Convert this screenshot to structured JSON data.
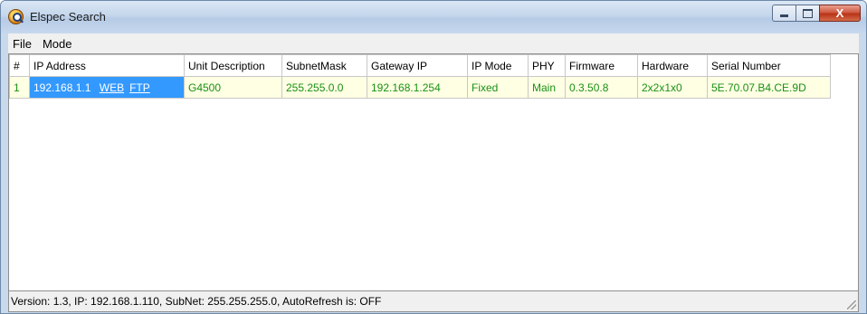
{
  "window": {
    "title": "Elspec Search",
    "icon": "elspec-search-icon",
    "controls": {
      "close_label": "X"
    }
  },
  "menu": [
    "File",
    "Mode"
  ],
  "table": {
    "columns": [
      "#",
      "IP Address",
      "Unit Description",
      "SubnetMask",
      "Gateway IP",
      "IP Mode",
      "PHY",
      "Firmware",
      "Hardware",
      "Serial Number"
    ],
    "rows": [
      {
        "num": "1",
        "ip": "192.168.1.1",
        "web_link": "WEB",
        "ftp_link": "FTP",
        "unit": "G4500",
        "subnet": "255.255.0.0",
        "gateway": "192.168.1.254",
        "ipmode": "Fixed",
        "phy": "Main",
        "firmware": "0.3.50.8",
        "hardware": "2x2x1x0",
        "serial": "5E.70.07.B4.CE.9D"
      }
    ]
  },
  "status": "Version: 1.3, IP: 192.168.1.110, SubNet: 255.255.255.0, AutoRefresh is: OFF",
  "colors": {
    "selection": "#3399ff",
    "row_bg": "#ffffe3",
    "row_text": "#199016"
  }
}
